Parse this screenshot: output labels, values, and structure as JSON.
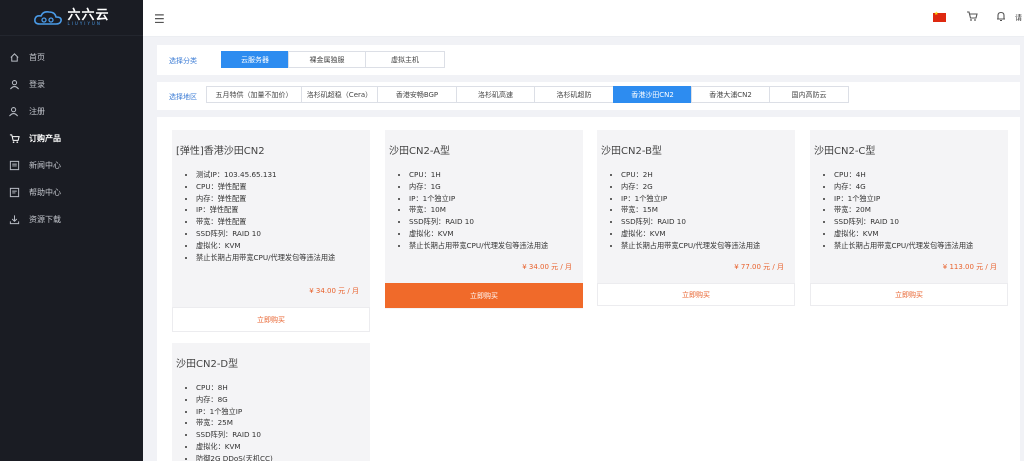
{
  "brand": {
    "name": "六六云",
    "subtitle": "LIUYIYUN"
  },
  "sidebar": {
    "items": [
      {
        "label": "首页",
        "icon": "home-icon"
      },
      {
        "label": "登录",
        "icon": "user-icon"
      },
      {
        "label": "注册",
        "icon": "user-add-icon"
      },
      {
        "label": "订购产品",
        "icon": "cart-icon",
        "active": true
      },
      {
        "label": "新闻中心",
        "icon": "news-icon"
      },
      {
        "label": "帮助中心",
        "icon": "help-icon"
      },
      {
        "label": "资源下载",
        "icon": "download-icon"
      }
    ]
  },
  "topbar": {
    "user_text": "请"
  },
  "filters": {
    "category_label": "选择分类",
    "categories": [
      "云服务器",
      "裸金属独服",
      "虚拟主机"
    ],
    "region_label": "选择地区",
    "regions": [
      "五月特供（加量不加价）",
      "洛杉矶超稳（Cera）",
      "香港安畅BGP",
      "洛杉矶高速",
      "洛杉矶超防",
      "香港沙田CN2",
      "香港大浦CN2",
      "国内高防云"
    ]
  },
  "products": [
    {
      "title": "[弹性]香港沙田CN2",
      "specs": [
        "测试IP：103.45.65.131",
        "CPU：弹性配置",
        "内存：弹性配置",
        "IP：弹性配置",
        "带宽：弹性配置",
        "SSD阵列：RAID 10",
        "虚拟化：KVM",
        "禁止长期占用带宽CPU/代理发包等违法用途"
      ],
      "price": "¥ 34.00 元 / 月",
      "buy_label": "立即购买"
    },
    {
      "title": "沙田CN2-A型",
      "specs": [
        "CPU：1H",
        "内存：1G",
        "IP：1个独立IP",
        "带宽：10M",
        "SSD阵列：RAID 10",
        "虚拟化：KVM",
        "禁止长期占用带宽CPU/代理发包等违法用途"
      ],
      "price": "¥ 34.00 元 / 月",
      "buy_label": "立即购买"
    },
    {
      "title": "沙田CN2-B型",
      "specs": [
        "CPU：2H",
        "内存：2G",
        "IP：1个独立IP",
        "带宽：15M",
        "SSD阵列：RAID 10",
        "虚拟化：KVM",
        "禁止长期占用带宽CPU/代理发包等违法用途"
      ],
      "price": "¥ 77.00 元 / 月",
      "buy_label": "立即购买"
    },
    {
      "title": "沙田CN2-C型",
      "specs": [
        "CPU：4H",
        "内存：4G",
        "IP：1个独立IP",
        "带宽：20M",
        "SSD阵列：RAID 10",
        "虚拟化：KVM",
        "禁止长期占用带宽CPU/代理发包等违法用途"
      ],
      "price": "¥ 113.00 元 / 月",
      "buy_label": "立即购买"
    },
    {
      "title": "沙田CN2-D型",
      "specs": [
        "CPU：8H",
        "内存：8G",
        "IP：1个独立IP",
        "带宽：25M",
        "SSD阵列：RAID 10",
        "虚拟化：KVM",
        "防御2G DDoS(天机CC)"
      ]
    }
  ],
  "colors": {
    "accent_blue": "#2d8cf0",
    "accent_orange": "#f06a2a",
    "sidebar_bg": "#1a1c23"
  }
}
